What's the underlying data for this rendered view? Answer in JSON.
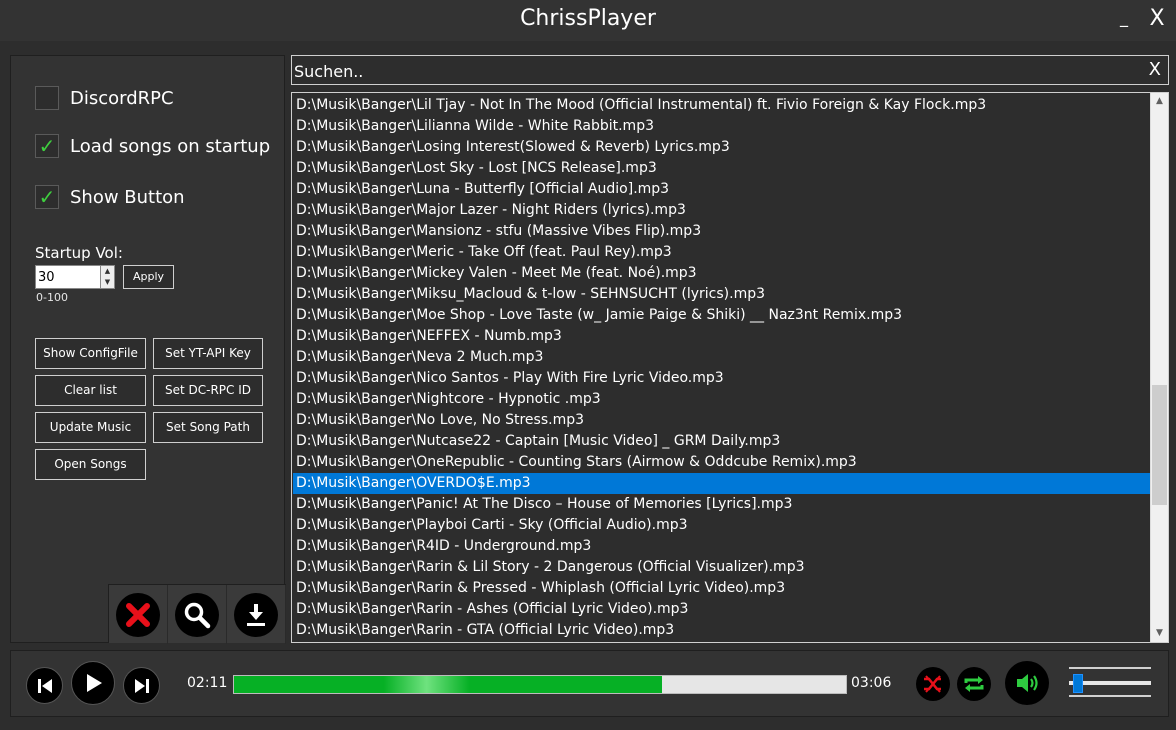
{
  "window": {
    "title": "ChrissPlayer",
    "minimize_label": "_",
    "close_label": "X"
  },
  "settings": {
    "discord_rpc": {
      "label": "DiscordRPC",
      "checked": false
    },
    "load_songs": {
      "label": "Load songs on startup",
      "checked": true
    },
    "show_button": {
      "label": "Show Button",
      "checked": true
    },
    "startup_vol_label": "Startup Vol:",
    "startup_vol_value": "30",
    "apply_label": "Apply",
    "range_label": "0-100",
    "check_mark": "✓"
  },
  "buttons": {
    "show_config": "Show ConfigFile",
    "set_yt_api": "Set YT-API Key",
    "clear_list": "Clear list",
    "set_dc_rpc": "Set DC-RPC ID",
    "update_music": "Update Music",
    "set_song_path": "Set Song Path",
    "open_songs": "Open Songs"
  },
  "toolbar_icons": [
    "delete-icon",
    "search-icon",
    "download-icon"
  ],
  "search": {
    "placeholder": "Suchen..",
    "clear_label": "X"
  },
  "songs": [
    "D:\\Musik\\Banger\\Lil Tjay - Not In The Mood (Official Instrumental) ft. Fivio Foreign & Kay Flock.mp3",
    "D:\\Musik\\Banger\\Lilianna Wilde - White Rabbit.mp3",
    "D:\\Musik\\Banger\\Losing Interest(Slowed & Reverb) Lyrics.mp3",
    "D:\\Musik\\Banger\\Lost Sky - Lost [NCS Release].mp3",
    "D:\\Musik\\Banger\\Luna - Butterfly [Official Audio].mp3",
    "D:\\Musik\\Banger\\Major Lazer - Night Riders (lyrics).mp3",
    "D:\\Musik\\Banger\\Mansionz - stfu (Massive Vibes Flip).mp3",
    "D:\\Musik\\Banger\\Meric - Take Off (feat. Paul Rey).mp3",
    "D:\\Musik\\Banger\\Mickey Valen - Meet Me (feat. Noé).mp3",
    "D:\\Musik\\Banger\\Miksu_Macloud & t-low - SEHNSUCHT (lyrics).mp3",
    "D:\\Musik\\Banger\\Moe Shop - Love Taste (w_ Jamie Paige & Shiki) __ Naz3nt Remix.mp3",
    "D:\\Musik\\Banger\\NEFFEX - Numb.mp3",
    "D:\\Musik\\Banger\\Neva 2 Much.mp3",
    "D:\\Musik\\Banger\\Nico Santos - Play With Fire Lyric Video.mp3",
    "D:\\Musik\\Banger\\Nightcore - Hypnotic .mp3",
    "D:\\Musik\\Banger\\No Love, No Stress.mp3",
    "D:\\Musik\\Banger\\Nutcase22 - Captain [Music Video] _ GRM Daily.mp3",
    "D:\\Musik\\Banger\\OneRepublic - Counting Stars (Airmow & Oddcube Remix).mp3",
    "D:\\Musik\\Banger\\OVERDO$E.mp3",
    "D:\\Musik\\Banger\\Panic! At The Disco – House of Memories [Lyrics].mp3",
    "D:\\Musik\\Banger\\Playboi Carti - Sky (Official Audio).mp3",
    "D:\\Musik\\Banger\\R4ID - Underground.mp3",
    "D:\\Musik\\Banger\\Rarin & Lil Story - 2 Dangerous (Official Visualizer).mp3",
    "D:\\Musik\\Banger\\Rarin & Pressed - Whiplash (Official Lyric Video).mp3",
    "D:\\Musik\\Banger\\Rarin - Ashes (Official Lyric Video).mp3",
    "D:\\Musik\\Banger\\Rarin - GTA (Official Lyric Video).mp3"
  ],
  "selected_index": 18,
  "player": {
    "current_time": "02:11",
    "total_time": "03:06",
    "progress_fraction": 0.7,
    "volume_fraction": 0.05,
    "accent_color": "#0078d7",
    "progress_color": "#06b025"
  }
}
